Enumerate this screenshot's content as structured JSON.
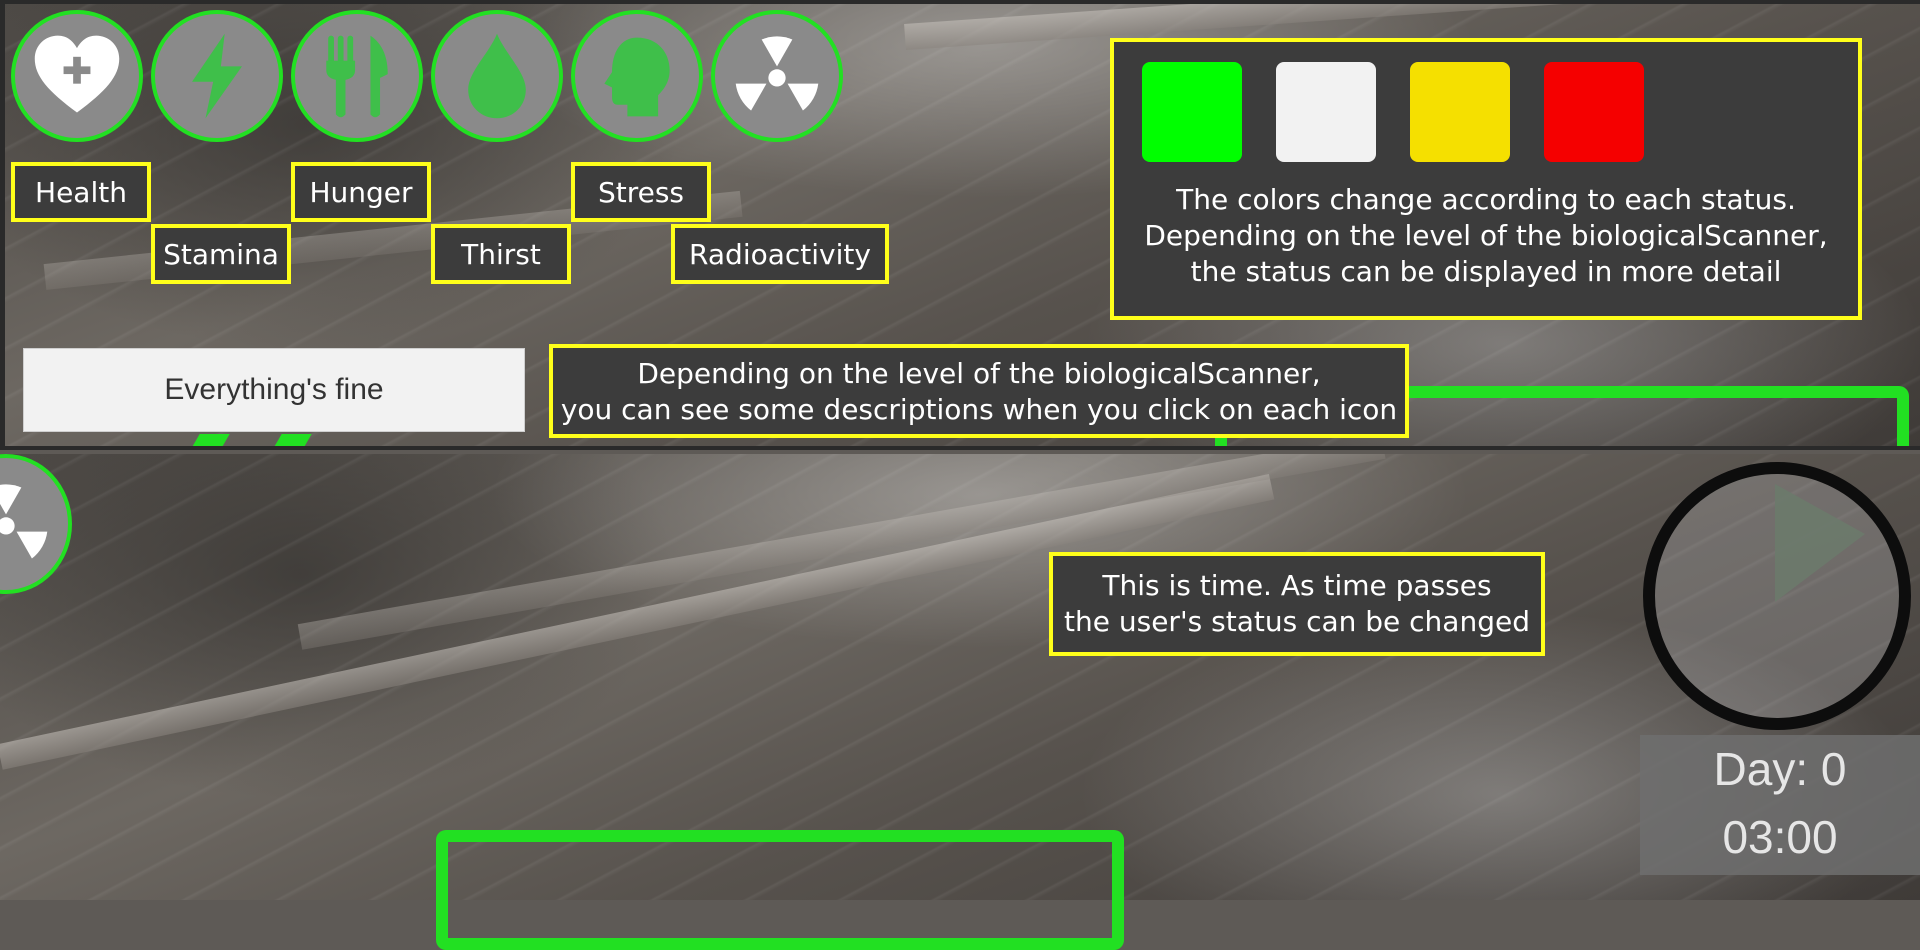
{
  "status_icons": [
    {
      "label": "Health",
      "icon": "heart-plus-icon",
      "color": "#ffffff"
    },
    {
      "label": "Stamina",
      "icon": "lightning-icon",
      "color": "#3fbf4a"
    },
    {
      "label": "Hunger",
      "icon": "fork-knife-icon",
      "color": "#3fbf4a"
    },
    {
      "label": "Thirst",
      "icon": "water-drop-icon",
      "color": "#3fbf4a"
    },
    {
      "label": "Stress",
      "icon": "head-icon",
      "color": "#3fbf4a"
    },
    {
      "label": "Radioactivity",
      "icon": "radiation-icon",
      "color": "#ffffff"
    }
  ],
  "icon_ring_color": "#22e022",
  "label_border_color": "#ffff1a",
  "color_legend": {
    "swatches": [
      "#00ff00",
      "#f2f2f2",
      "#f5e000",
      "#f50000"
    ],
    "lines": [
      "The colors change according to each status.",
      "Depending on the level of the biologicalScanner,",
      "the status can be displayed in more detail"
    ]
  },
  "status_message": "Everything's fine",
  "scanner_note": {
    "lines": [
      "Depending on the level of the biologicalScanner,",
      "you can see some descriptions when you click on each icon"
    ]
  },
  "time_note": {
    "lines": [
      "This is time. As time passes",
      "the user's status can be changed"
    ]
  },
  "clock": {
    "day": "Day: 0",
    "time": "03:00"
  }
}
